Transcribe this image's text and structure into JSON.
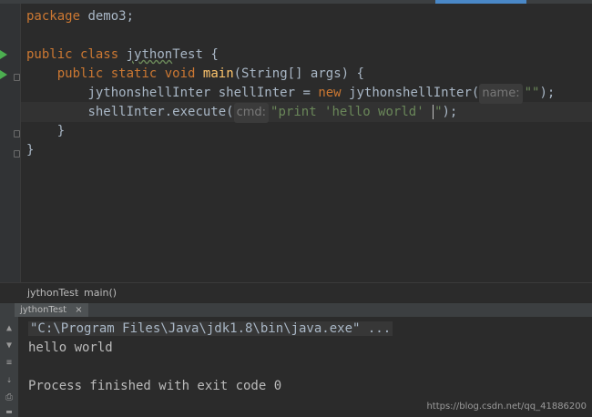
{
  "editor": {
    "lines": {
      "l1": {
        "kw": "package",
        "rest": " demo3;"
      },
      "l2": {
        "kw1": "public",
        "kw2": "class",
        "cls": "jython",
        "cls2": "Test",
        "brace": " {"
      },
      "l3": {
        "kw1": "public",
        "kw2": "static",
        "kw3": "void",
        "fn": "main",
        "rest": "(String[] args) {"
      },
      "l4": {
        "decl": "jythonshellInter shellInter = ",
        "kw": "new",
        "ctor": " jythonshellInter(",
        "hint": "name:",
        "str": "\"\"",
        "end": ");"
      },
      "l5": {
        "call": "shellInter.execute(",
        "hint": "cmd:",
        "str1": "\"print 'hello world' ",
        "str2": "\"",
        "end": ");"
      },
      "l6": {
        "text": "}"
      },
      "l7": {
        "text": "}"
      }
    }
  },
  "breadcrumb": {
    "class": "jythonTest",
    "sep": "›",
    "method": "main()"
  },
  "run": {
    "tab_label": "jythonTest",
    "close": "×"
  },
  "console": {
    "cmd": "\"C:\\Program Files\\Java\\jdk1.8\\bin\\java.exe\" ...",
    "output": "hello world",
    "exit": "Process finished with exit code 0"
  },
  "watermark": "https://blog.csdn.net/qq_41886200",
  "icons": [
    "run-gutter-icon",
    "fold-icon",
    "up-arrow-icon",
    "down-arrow-icon",
    "wrap-icon",
    "scroll-end-icon",
    "print-icon",
    "trash-icon"
  ]
}
